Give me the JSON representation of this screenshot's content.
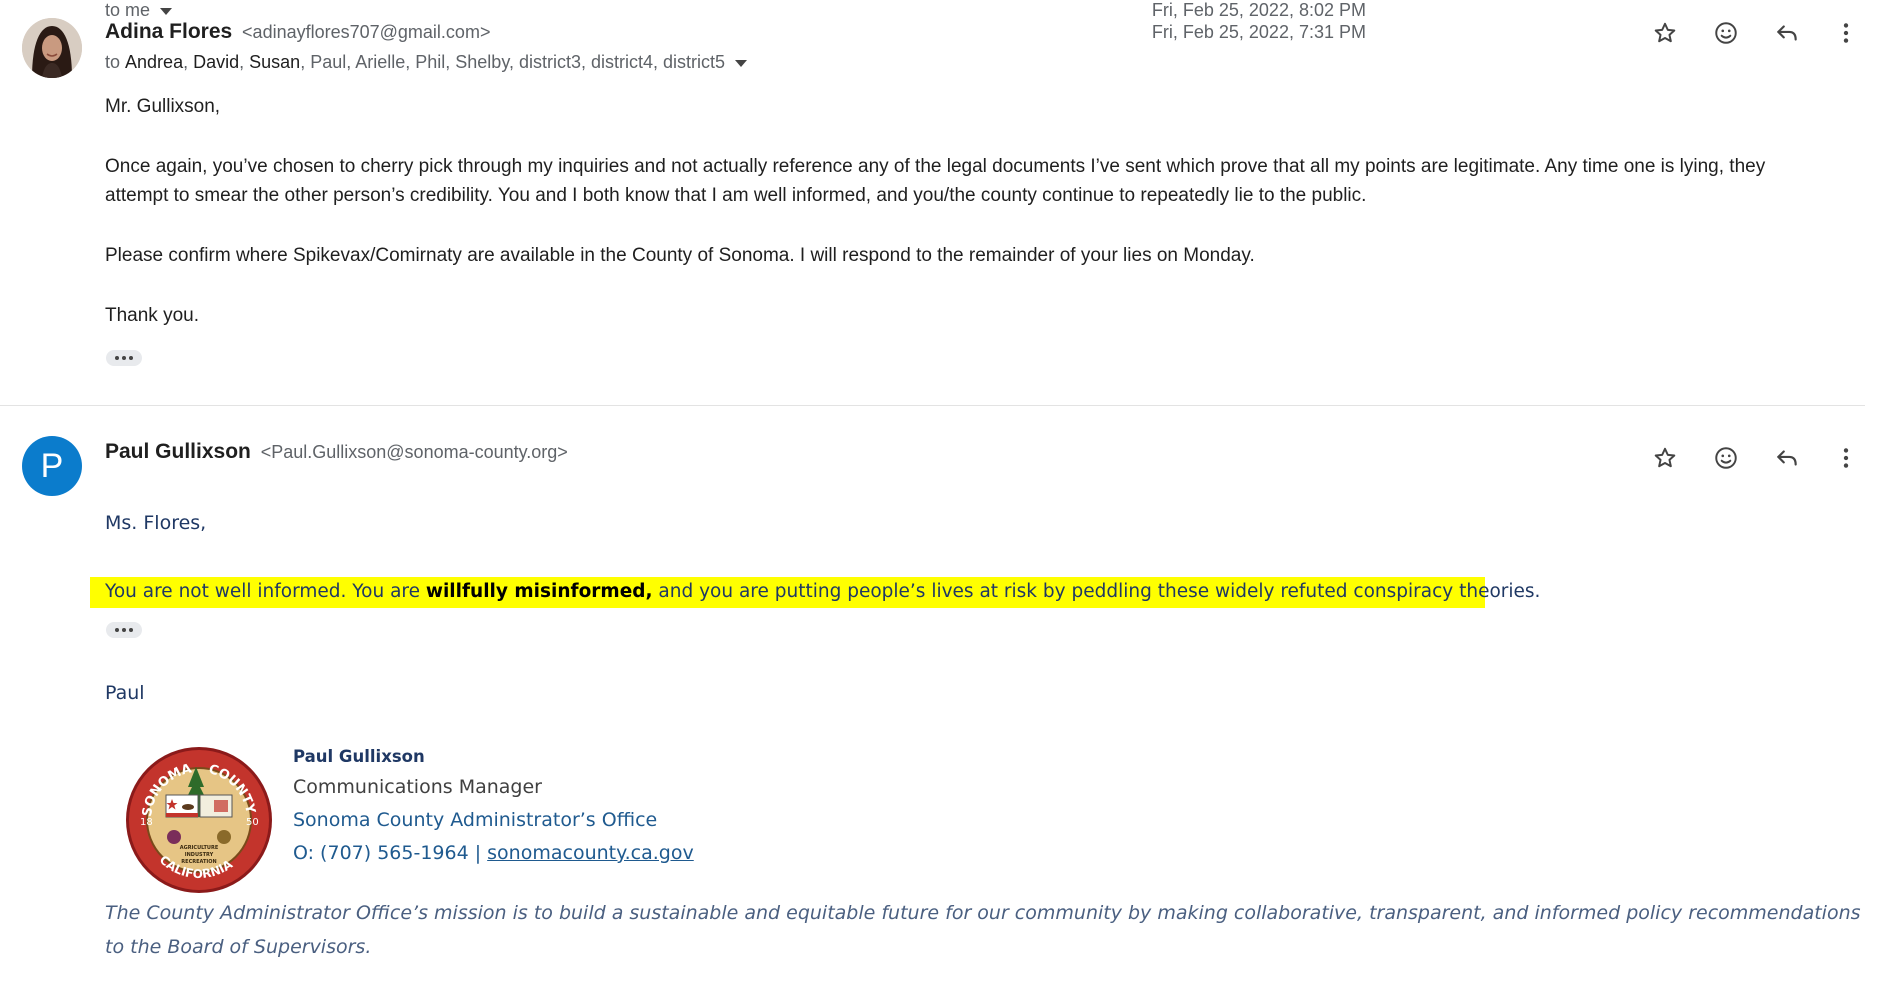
{
  "messages": [
    {
      "sender_name": "Adina Flores",
      "sender_email": "<adinayflores707@gmail.com>",
      "to_prefix": "to",
      "recipients_strong": [
        "Andrea",
        "David",
        "Susan"
      ],
      "recipients_rest": "Paul, Arielle, Phil, Shelby, district3, district4, district5",
      "date": "Fri, Feb 25, 2022, 7:31 PM",
      "body": [
        "Mr. Gullixson,",
        "Once again, you’ve chosen to cherry pick through my inquiries and not actually reference any of the legal documents I’ve sent which prove that all my points are legitimate. Any time one is lying, they attempt to smear the other person’s credibility. You and I both know that I am well informed, and you/the county continue to repeatedly lie to the public.",
        "Please confirm where Spikevax/Comirnaty are available in the County of Sonoma. I will respond to the remainder of your lies on Monday.",
        "Thank you."
      ]
    },
    {
      "avatar_letter": "P",
      "sender_name": "Paul Gullixson",
      "sender_email": "<Paul.Gullixson@sonoma-county.org>",
      "to_line": "to me",
      "date": "Fri, Feb 25, 2022, 8:02 PM",
      "greeting": "Ms. Flores,",
      "highlight_part1": "You are not well informed. You are ",
      "highlight_bold": "willfully misinformed,",
      "highlight_part2": " and you are putting people’s lives at risk by peddling these widely refuted conspiracy theories.",
      "closing": "Paul",
      "signature": {
        "name": "Paul Gullixson",
        "title": "Communications Manager",
        "office": "Sonoma County Administrator’s Office",
        "phone": "O: (707) 565-1964 | ",
        "website": "sonomacounty.ca.gov",
        "seal_text": [
          "SONOMA",
          "COUNTY",
          "CALIFORNIA",
          "18",
          "50",
          "AGRICULTURE",
          "INDUSTRY",
          "RECREATION"
        ]
      },
      "mission": "The County Administrator Office’s mission is to build a sustainable and equitable future for our community by making collaborative, transparent, and informed policy recommendations to the Board of Supervisors."
    }
  ],
  "icons": [
    "star-icon",
    "emoji-icon",
    "reply-icon",
    "more-vert-icon",
    "chevron-down-icon",
    "ellipsis-icon"
  ],
  "colors": {
    "highlight": "#ffff00",
    "avatar_blue": "#0b7ccc",
    "signature_navy": "#1f3864",
    "link_blue": "#1f5a8f"
  }
}
